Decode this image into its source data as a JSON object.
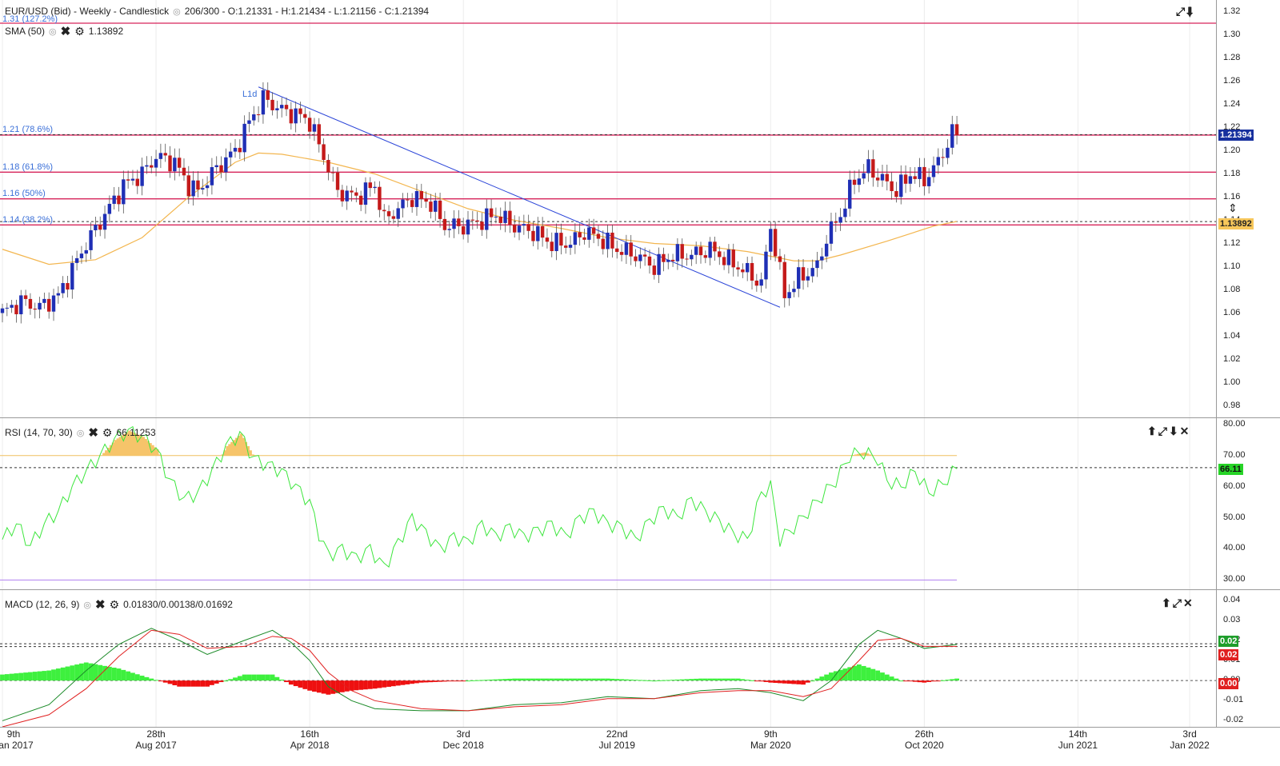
{
  "main_header": {
    "title": "EUR/USD (Bid) - Weekly - Candlestick",
    "ohlc": "206/300 - O:1.21331 - H:1.21434 - L:1.21156 - C:1.21394",
    "sma_label": "SMA (50)",
    "sma_value": "1.13892",
    "eye_icon": "eye-icon",
    "close_icon": "close-icon",
    "gear_icon": "gear-icon"
  },
  "fib_labels": [
    {
      "text": "1.31 (127.2%)",
      "price": 1.31
    },
    {
      "text": "1.21 (78.6%)",
      "price": 1.2135
    },
    {
      "text": "1.18 (61.8%)",
      "price": 1.1815
    },
    {
      "text": "1.16 (50%)",
      "price": 1.1585
    },
    {
      "text": "1.14 (38.2%)",
      "price": 1.136
    }
  ],
  "trend_label": "L1d",
  "price_axis": {
    "ticks": [
      "1.32",
      "1.30",
      "1.28",
      "1.26",
      "1.24",
      "1.22",
      "1.20",
      "1.18",
      "1.16",
      "1.14",
      "1.12",
      "1.10",
      "1.08",
      "1.06",
      "1.04",
      "1.02",
      "1.00",
      "0.98"
    ],
    "last_price": "1.21394",
    "sma_tag": "1.13892",
    "min": 0.97,
    "max": 1.33
  },
  "rsi_header": {
    "label": "RSI (14, 70, 30)",
    "value": "66.11253"
  },
  "rsi_axis": {
    "ticks": [
      "80.00",
      "70.00",
      "60.00",
      "50.00",
      "40.00",
      "30.00"
    ],
    "tag": "66.11",
    "overbought": 70,
    "oversold": 30,
    "min": 27,
    "max": 82
  },
  "macd_header": {
    "label": "MACD (12, 26, 9)",
    "value": "0.01830/0.00138/0.01692"
  },
  "macd_axis": {
    "ticks": [
      "0.04",
      "0.03",
      "0.02",
      "0.01",
      "0.00",
      "-0.01",
      "-0.02"
    ],
    "tag_macd": "0.02",
    "tag_signal": "0.02",
    "tag_zero": "0.00",
    "min": -0.023,
    "max": 0.045
  },
  "x_axis": [
    {
      "line1": "9th",
      "line2": "Jan 2017",
      "week": 0
    },
    {
      "line1": "28th",
      "line2": "Aug 2017",
      "week": 33
    },
    {
      "line1": "16th",
      "line2": "Apr 2018",
      "week": 66
    },
    {
      "line1": "3rd",
      "line2": "Dec 2018",
      "week": 99
    },
    {
      "line1": "22nd",
      "line2": "Jul 2019",
      "week": 132
    },
    {
      "line1": "9th",
      "line2": "Mar 2020",
      "week": 165
    },
    {
      "line1": "26th",
      "line2": "Oct 2020",
      "week": 198
    },
    {
      "line1": "14th",
      "line2": "Jun 2021",
      "week": 231
    },
    {
      "line1": "3rd",
      "line2": "Jan 2022",
      "week": 255
    }
  ],
  "toolbar_icons": [
    "expand-icon",
    "arrow-down-icon",
    "arrow-up-icon",
    "close-icon"
  ],
  "colors": {
    "bull": "#1f2fb5",
    "bear": "#c41a1a",
    "sma": "#f3b64f",
    "fib": "#d6245a",
    "rsi": "#3ee63e",
    "macd_hist_pos": "#3ef03e",
    "macd_hist_neg": "#ee1010",
    "trend": "#2a44d8"
  },
  "chart_data": {
    "type": "candlestick",
    "title": "EUR/USD (Bid) - Weekly - Candlestick",
    "close_points_weekly": [
      [
        0,
        1.06
      ],
      [
        4,
        1.07
      ],
      [
        8,
        1.065
      ],
      [
        12,
        1.075
      ],
      [
        14,
        1.09
      ],
      [
        18,
        1.12
      ],
      [
        22,
        1.145
      ],
      [
        26,
        1.17
      ],
      [
        30,
        1.18
      ],
      [
        33,
        1.195
      ],
      [
        37,
        1.19
      ],
      [
        40,
        1.17
      ],
      [
        42,
        1.165
      ],
      [
        46,
        1.185
      ],
      [
        50,
        1.2
      ],
      [
        53,
        1.225
      ],
      [
        56,
        1.245
      ],
      [
        60,
        1.235
      ],
      [
        64,
        1.23
      ],
      [
        66,
        1.225
      ],
      [
        69,
        1.195
      ],
      [
        72,
        1.165
      ],
      [
        76,
        1.16
      ],
      [
        80,
        1.17
      ],
      [
        82,
        1.14
      ],
      [
        85,
        1.15
      ],
      [
        88,
        1.16
      ],
      [
        92,
        1.155
      ],
      [
        95,
        1.135
      ],
      [
        99,
        1.135
      ],
      [
        103,
        1.14
      ],
      [
        106,
        1.145
      ],
      [
        110,
        1.135
      ],
      [
        114,
        1.13
      ],
      [
        118,
        1.12
      ],
      [
        122,
        1.12
      ],
      [
        125,
        1.13
      ],
      [
        128,
        1.125
      ],
      [
        132,
        1.115
      ],
      [
        136,
        1.11
      ],
      [
        140,
        1.1
      ],
      [
        144,
        1.11
      ],
      [
        148,
        1.11
      ],
      [
        152,
        1.115
      ],
      [
        156,
        1.105
      ],
      [
        160,
        1.095
      ],
      [
        163,
        1.085
      ],
      [
        165,
        1.135
      ],
      [
        168,
        1.075
      ],
      [
        171,
        1.09
      ],
      [
        175,
        1.1
      ],
      [
        177,
        1.125
      ],
      [
        180,
        1.145
      ],
      [
        183,
        1.175
      ],
      [
        186,
        1.185
      ],
      [
        189,
        1.175
      ],
      [
        192,
        1.165
      ],
      [
        195,
        1.18
      ],
      [
        198,
        1.175
      ],
      [
        201,
        1.19
      ],
      [
        204,
        1.215
      ]
    ],
    "sma50_points_weekly": [
      [
        0,
        1.115
      ],
      [
        10,
        1.102
      ],
      [
        20,
        1.106
      ],
      [
        30,
        1.125
      ],
      [
        40,
        1.16
      ],
      [
        50,
        1.19
      ],
      [
        55,
        1.198
      ],
      [
        60,
        1.197
      ],
      [
        70,
        1.19
      ],
      [
        80,
        1.18
      ],
      [
        90,
        1.165
      ],
      [
        100,
        1.15
      ],
      [
        110,
        1.14
      ],
      [
        120,
        1.133
      ],
      [
        130,
        1.125
      ],
      [
        140,
        1.12
      ],
      [
        150,
        1.118
      ],
      [
        160,
        1.113
      ],
      [
        170,
        1.105
      ],
      [
        175,
        1.105
      ],
      [
        180,
        1.11
      ],
      [
        190,
        1.122
      ],
      [
        200,
        1.135
      ],
      [
        205,
        1.139
      ]
    ],
    "trendline": {
      "from": [
        55,
        1.255
      ],
      "to": [
        167,
        1.065
      ]
    },
    "rsi_points_weekly": [
      [
        0,
        43
      ],
      [
        3,
        48
      ],
      [
        6,
        41
      ],
      [
        9,
        48
      ],
      [
        12,
        52
      ],
      [
        15,
        60
      ],
      [
        18,
        65
      ],
      [
        21,
        70
      ],
      [
        24,
        75
      ],
      [
        27,
        78
      ],
      [
        30,
        76
      ],
      [
        33,
        72
      ],
      [
        36,
        62
      ],
      [
        39,
        56
      ],
      [
        42,
        58
      ],
      [
        45,
        65
      ],
      [
        48,
        73
      ],
      [
        51,
        77
      ],
      [
        54,
        69
      ],
      [
        57,
        67
      ],
      [
        60,
        65
      ],
      [
        63,
        60
      ],
      [
        66,
        55
      ],
      [
        68,
        45
      ],
      [
        70,
        38
      ],
      [
        73,
        40
      ],
      [
        76,
        37
      ],
      [
        79,
        40
      ],
      [
        82,
        34
      ],
      [
        85,
        42
      ],
      [
        88,
        50
      ],
      [
        91,
        45
      ],
      [
        94,
        40
      ],
      [
        97,
        44
      ],
      [
        100,
        42
      ],
      [
        103,
        48
      ],
      [
        106,
        44
      ],
      [
        109,
        47
      ],
      [
        112,
        44
      ],
      [
        115,
        46
      ],
      [
        118,
        48
      ],
      [
        121,
        44
      ],
      [
        124,
        50
      ],
      [
        127,
        52
      ],
      [
        130,
        48
      ],
      [
        133,
        47
      ],
      [
        136,
        43
      ],
      [
        139,
        49
      ],
      [
        142,
        53
      ],
      [
        145,
        50
      ],
      [
        148,
        56
      ],
      [
        151,
        52
      ],
      [
        154,
        49
      ],
      [
        157,
        45
      ],
      [
        160,
        43
      ],
      [
        163,
        58
      ],
      [
        165,
        60
      ],
      [
        167,
        43
      ],
      [
        170,
        47
      ],
      [
        173,
        52
      ],
      [
        176,
        57
      ],
      [
        179,
        62
      ],
      [
        182,
        70
      ],
      [
        185,
        71
      ],
      [
        188,
        69
      ],
      [
        190,
        62
      ],
      [
        193,
        60
      ],
      [
        196,
        65
      ],
      [
        199,
        58
      ],
      [
        202,
        61
      ],
      [
        205,
        66
      ]
    ],
    "macd_points_weekly": [
      [
        0,
        -0.02
      ],
      [
        10,
        -0.012
      ],
      [
        18,
        0.005
      ],
      [
        25,
        0.018
      ],
      [
        32,
        0.026
      ],
      [
        38,
        0.02
      ],
      [
        44,
        0.013
      ],
      [
        52,
        0.02
      ],
      [
        58,
        0.025
      ],
      [
        62,
        0.019
      ],
      [
        66,
        0.01
      ],
      [
        70,
        -0.003
      ],
      [
        75,
        -0.01
      ],
      [
        80,
        -0.014
      ],
      [
        90,
        -0.015
      ],
      [
        100,
        -0.015
      ],
      [
        110,
        -0.012
      ],
      [
        120,
        -0.011
      ],
      [
        130,
        -0.008
      ],
      [
        140,
        -0.009
      ],
      [
        150,
        -0.005
      ],
      [
        158,
        -0.004
      ],
      [
        165,
        -0.006
      ],
      [
        172,
        -0.01
      ],
      [
        178,
        0.0
      ],
      [
        184,
        0.018
      ],
      [
        188,
        0.025
      ],
      [
        193,
        0.021
      ],
      [
        198,
        0.016
      ],
      [
        205,
        0.018
      ]
    ],
    "signal_points_weekly": [
      [
        0,
        -0.023
      ],
      [
        10,
        -0.017
      ],
      [
        18,
        -0.004
      ],
      [
        25,
        0.012
      ],
      [
        32,
        0.025
      ],
      [
        38,
        0.023
      ],
      [
        44,
        0.016
      ],
      [
        52,
        0.017
      ],
      [
        58,
        0.022
      ],
      [
        62,
        0.021
      ],
      [
        66,
        0.015
      ],
      [
        70,
        0.004
      ],
      [
        75,
        -0.005
      ],
      [
        80,
        -0.01
      ],
      [
        90,
        -0.014
      ],
      [
        100,
        -0.015
      ],
      [
        110,
        -0.013
      ],
      [
        120,
        -0.012
      ],
      [
        130,
        -0.009
      ],
      [
        140,
        -0.009
      ],
      [
        150,
        -0.006
      ],
      [
        158,
        -0.005
      ],
      [
        165,
        -0.005
      ],
      [
        172,
        -0.008
      ],
      [
        178,
        -0.004
      ],
      [
        184,
        0.01
      ],
      [
        188,
        0.02
      ],
      [
        193,
        0.021
      ],
      [
        198,
        0.017
      ],
      [
        205,
        0.017
      ]
    ],
    "ylim": [
      0.97,
      1.33
    ]
  }
}
